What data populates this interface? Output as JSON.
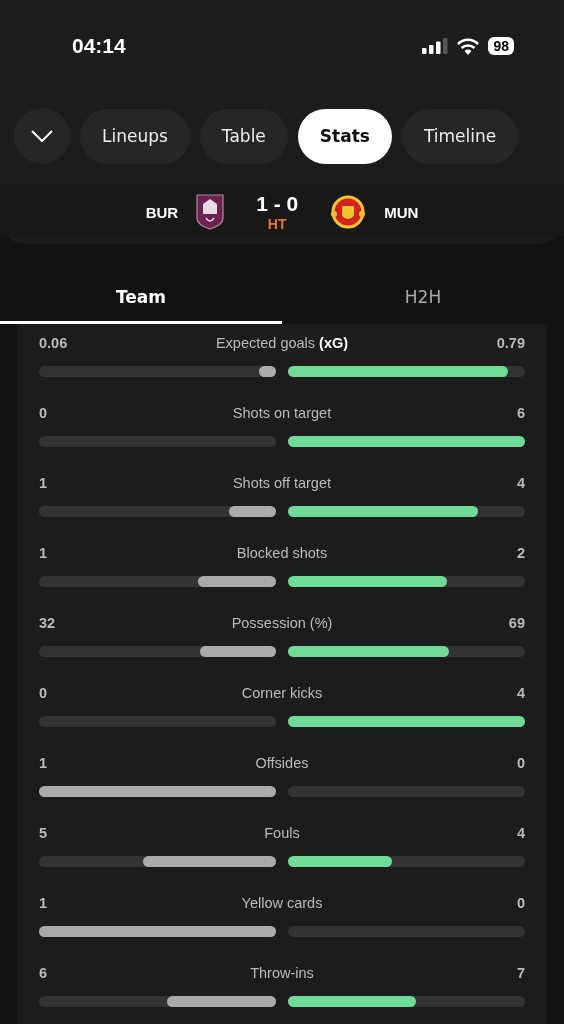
{
  "status_bar": {
    "time": "04:14",
    "battery": "98"
  },
  "nav": {
    "pills": [
      {
        "label": "Lineups",
        "selected": false
      },
      {
        "label": "Table",
        "selected": false
      },
      {
        "label": "Stats",
        "selected": true
      },
      {
        "label": "Timeline",
        "selected": false
      }
    ]
  },
  "match": {
    "home": "BUR",
    "score": "1 - 0",
    "status": "HT",
    "away": "MUN"
  },
  "tabs": [
    {
      "label": "Team",
      "selected": true
    },
    {
      "label": "H2H",
      "selected": false
    }
  ],
  "stats": [
    {
      "name": "Expected goals **(xG)**",
      "home": "0.06",
      "away": "0.79",
      "home_bar": {
        "level": 0.07
      },
      "away_bar": {
        "level": 0.93
      }
    },
    {
      "name": "Shots on target",
      "home": "0",
      "away": "6",
      "away_bar": {
        "level": 1
      }
    },
    {
      "name": "Shots off target",
      "home": "1",
      "away": "4",
      "home_bar": {
        "level": 0.2
      },
      "away_bar": {
        "level": 0.8
      }
    },
    {
      "name": "Blocked shots",
      "home": "1",
      "away": "2",
      "home_bar": {
        "level": 0.33
      },
      "away_bar": {
        "level": 0.67
      }
    },
    {
      "name": "Possession (%)",
      "home": "32",
      "away": "69",
      "home_bar": {
        "level": 0.32
      },
      "away_bar": {
        "level": 0.68
      }
    },
    {
      "name": "Corner kicks",
      "home": "0",
      "away": "4",
      "away_bar": {
        "level": 1
      }
    },
    {
      "name": "Offsides",
      "home": "1",
      "away": "0",
      "home_bar": {
        "level": 1
      }
    },
    {
      "name": "Fouls",
      "home": "5",
      "away": "4",
      "home_bar": {
        "level": 0.56
      },
      "away_bar": {
        "level": 0.44
      }
    },
    {
      "name": "Yellow cards",
      "home": "1",
      "away": "0",
      "home_bar": {
        "level": 1
      }
    },
    {
      "name": "Throw-ins",
      "home": "6",
      "away": "7",
      "home_bar": {
        "level": 0.46
      },
      "away_bar": {
        "level": 0.54
      }
    }
  ]
}
